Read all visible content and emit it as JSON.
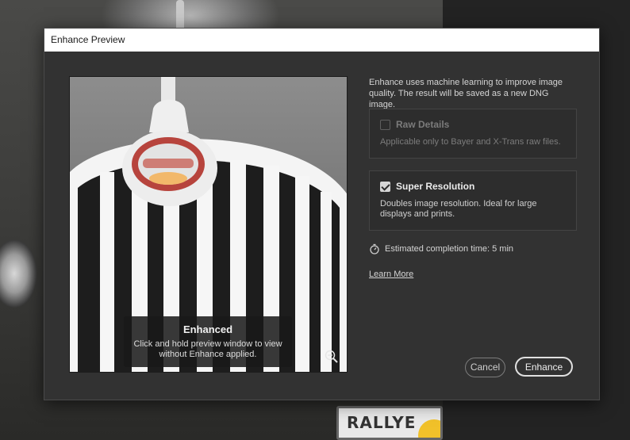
{
  "dialog": {
    "title": "Enhance Preview"
  },
  "preview": {
    "overlay_title": "Enhanced",
    "overlay_text": "Click and hold preview window to view without Enhance applied."
  },
  "intro": "Enhance uses machine learning to improve image quality. The result will be saved as a new DNG image.",
  "options": {
    "raw_details": {
      "label": "Raw Details",
      "description": "Applicable only to Bayer and X-Trans raw files.",
      "checked": false,
      "enabled": false
    },
    "super_resolution": {
      "label": "Super Resolution",
      "description": "Doubles image resolution. Ideal for large displays and prints.",
      "checked": true,
      "enabled": true
    }
  },
  "estimate": "Estimated completion time: 5 min",
  "learn_more": "Learn More",
  "buttons": {
    "cancel": "Cancel",
    "enhance": "Enhance"
  },
  "background": {
    "plate_text": "RALLYE"
  },
  "icons": {
    "zoom": "zoom-out-icon",
    "timer": "stopwatch-icon"
  }
}
